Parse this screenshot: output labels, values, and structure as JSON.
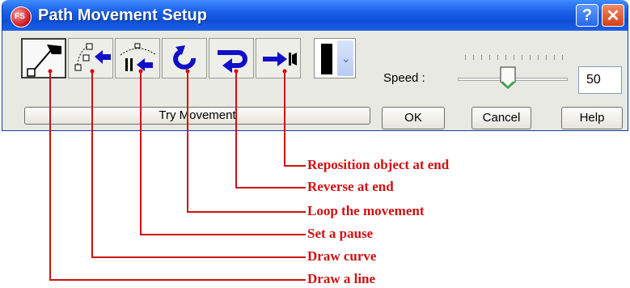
{
  "window": {
    "title": "Path Movement Setup",
    "help_button": "?",
    "close_button": "✕",
    "app_icon_text": "FS"
  },
  "toolbar": {
    "tools": [
      {
        "name": "draw-a-line"
      },
      {
        "name": "draw-curve"
      },
      {
        "name": "set-a-pause"
      },
      {
        "name": "loop-the-movement"
      },
      {
        "name": "reverse-at-end"
      },
      {
        "name": "reposition-object-at-end"
      }
    ],
    "color_dropdown_arrow": "⌄"
  },
  "speed": {
    "label": "Speed :",
    "value": "50"
  },
  "buttons": {
    "try": "Try Movement",
    "ok": "OK",
    "cancel": "Cancel",
    "help": "Help"
  },
  "annotations": [
    "Reposition object at end",
    "Reverse at end",
    "Loop the movement",
    "Set a pause",
    "Draw curve",
    "Draw a line"
  ],
  "colors": {
    "annotation": "#d01010",
    "titlebar": "#1a5ee8",
    "icon_blue": "#1010c8"
  }
}
